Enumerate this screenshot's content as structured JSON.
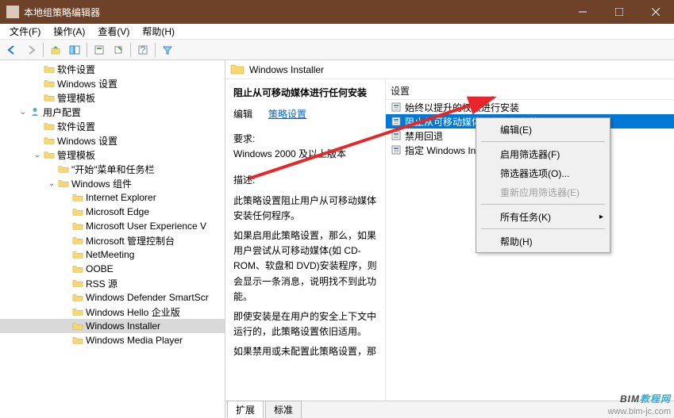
{
  "window": {
    "title": "本地组策略编辑器"
  },
  "menu": {
    "file": "文件(F)",
    "action": "操作(A)",
    "view": "查看(V)",
    "help": "帮助(H)"
  },
  "tree": {
    "items": [
      {
        "indent": 2,
        "exp": "",
        "label": "软件设置"
      },
      {
        "indent": 2,
        "exp": "",
        "label": "Windows 设置"
      },
      {
        "indent": 2,
        "exp": "",
        "label": "管理模板"
      },
      {
        "indent": 1,
        "exp": "v",
        "label": "用户配置",
        "userIcon": true
      },
      {
        "indent": 2,
        "exp": "",
        "label": "软件设置"
      },
      {
        "indent": 2,
        "exp": "",
        "label": "Windows 设置"
      },
      {
        "indent": 2,
        "exp": "v",
        "label": "管理模板"
      },
      {
        "indent": 3,
        "exp": "",
        "label": "\"开始\"菜单和任务栏"
      },
      {
        "indent": 3,
        "exp": "v",
        "label": "Windows 组件"
      },
      {
        "indent": 4,
        "exp": "",
        "label": "Internet Explorer"
      },
      {
        "indent": 4,
        "exp": "",
        "label": "Microsoft Edge"
      },
      {
        "indent": 4,
        "exp": "",
        "label": "Microsoft User Experience V"
      },
      {
        "indent": 4,
        "exp": "",
        "label": "Microsoft 管理控制台"
      },
      {
        "indent": 4,
        "exp": "",
        "label": "NetMeeting"
      },
      {
        "indent": 4,
        "exp": "",
        "label": "OOBE"
      },
      {
        "indent": 4,
        "exp": "",
        "label": "RSS 源"
      },
      {
        "indent": 4,
        "exp": "",
        "label": "Windows Defender SmartScr"
      },
      {
        "indent": 4,
        "exp": "",
        "label": "Windows Hello 企业版"
      },
      {
        "indent": 4,
        "exp": "",
        "label": "Windows Installer",
        "selected": true
      },
      {
        "indent": 4,
        "exp": "",
        "label": "Windows Media Player"
      }
    ]
  },
  "path": {
    "label": "Windows Installer"
  },
  "details": {
    "title": "阻止从可移动媒体进行任何安装",
    "editPrefix": "编辑",
    "editLink": "策略设置",
    "reqLabel": "要求:",
    "reqValue": "Windows 2000 及以上版本",
    "descLabel": "描述:",
    "desc1": "此策略设置阻止用户从可移动媒体安装任何程序。",
    "desc2": "如果启用此策略设置，那么，如果用户尝试从可移动媒体(如 CD-ROM、软盘和 DVD)安装程序，则会显示一条消息，说明找不到此功能。",
    "desc3": "即使安装是在用户的安全上下文中运行的，此策略设置依旧适用。",
    "desc4": "如果禁用或未配置此策略设置，那"
  },
  "list": {
    "header": "设置",
    "items": [
      {
        "label": "始终以提升的权限进行安装"
      },
      {
        "label": "阻止从可移动媒体进行任何安装",
        "selected": true
      },
      {
        "label": "禁用回退"
      },
      {
        "label": "指定 Windows Installer 搜索文件夹的顺序"
      }
    ]
  },
  "tabs": {
    "extended": "扩展",
    "standard": "标准"
  },
  "context": {
    "edit": "编辑(E)",
    "enableFilter": "启用筛选器(F)",
    "filterOptions": "筛选器选项(O)...",
    "reapplyFilter": "重新应用筛选器(E)",
    "allTasks": "所有任务(K)",
    "help": "帮助(H)"
  },
  "watermark": {
    "brand": "BIM教程网",
    "url": "www.bim-jc.com"
  }
}
